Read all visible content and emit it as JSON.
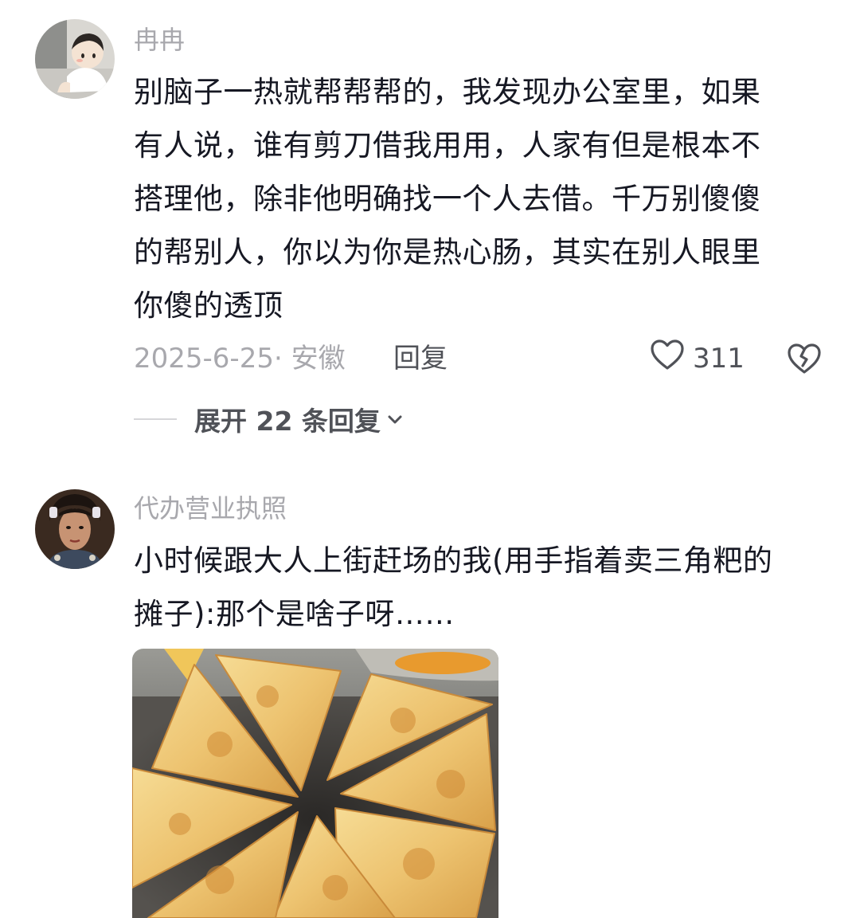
{
  "comments": [
    {
      "username": "冉冉",
      "content_lines": [
        "别脑子一热就帮帮帮的，我发现办公室里，如果",
        "有人说，谁有剪刀借我用用，人家有但是根本不",
        "搭理他，除非他明确找一个人去借。千万别傻傻",
        "的帮别人，你以为你是热心肠，其实在别人眼里",
        "你傻的透顶"
      ],
      "date_location": "2025-6-25· 安徽",
      "reply_label": "回复",
      "like_count": "311",
      "expand_label": "展开 22 条回复"
    },
    {
      "username": "代办营业执照",
      "content_lines": [
        "小时候跟大人上街赶场的我(用手指着卖三角粑的",
        "摊子):那个是啥子呀……"
      ]
    }
  ],
  "icons": {
    "like": "heart-outline-icon",
    "dislike": "broken-heart-icon",
    "expand": "chevron-down-icon"
  },
  "colors": {
    "text": "#161823",
    "secondary": "#a8a8ad",
    "action": "#505258"
  }
}
